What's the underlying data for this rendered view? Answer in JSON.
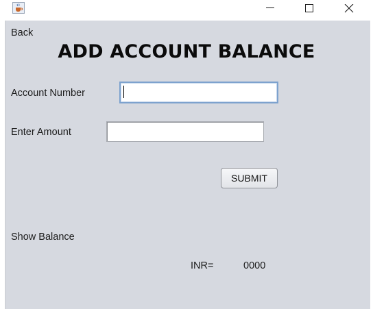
{
  "window": {
    "icon": "java-cup-icon"
  },
  "nav": {
    "back_label": "Back"
  },
  "page": {
    "title": "ADD ACCOUNT BALANCE"
  },
  "form": {
    "account_number_label": "Account Number",
    "account_number_value": "",
    "amount_label": "Enter Amount",
    "amount_value": "",
    "submit_label": "SUBMIT"
  },
  "balance": {
    "show_label": "Show Balance",
    "currency_label": "INR=",
    "value": "0000"
  },
  "colors": {
    "client_background": "#d6d9e0",
    "focused_field_border": "#7da2ce"
  }
}
